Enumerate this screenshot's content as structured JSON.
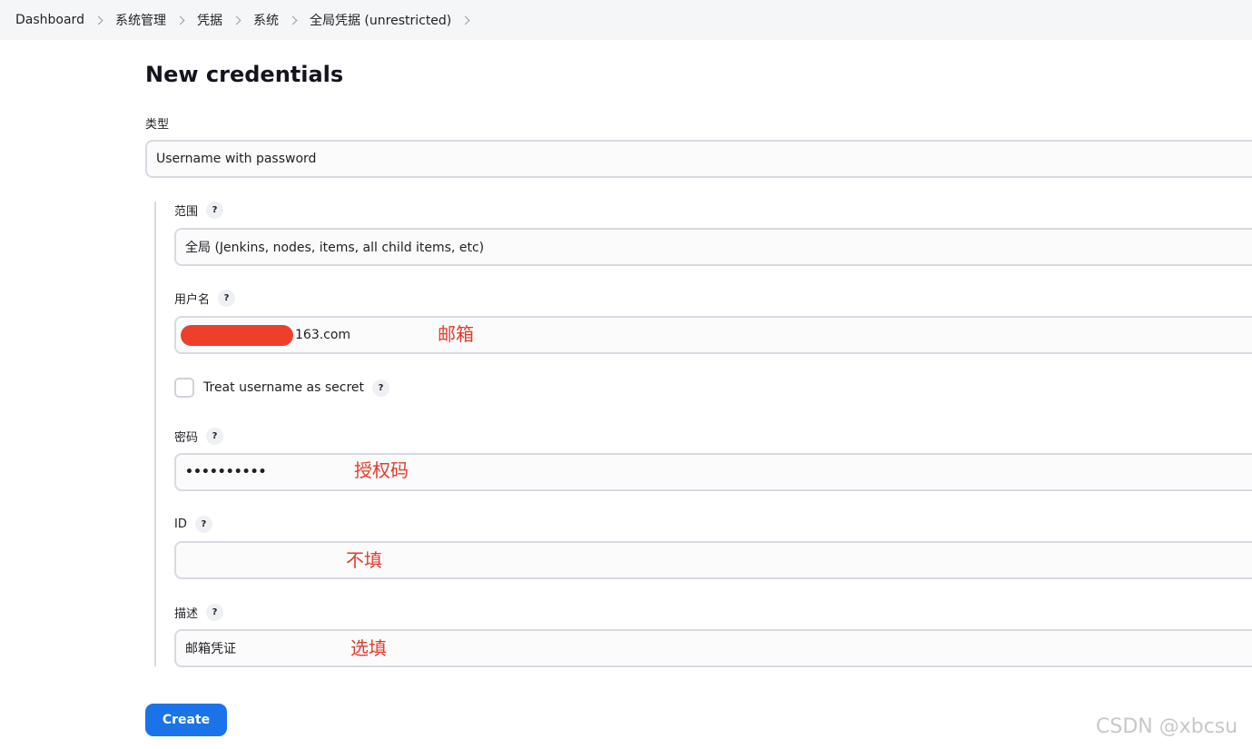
{
  "breadcrumb": {
    "items": [
      "Dashboard",
      "系统管理",
      "凭据",
      "系统",
      "全局凭据 (unrestricted)"
    ]
  },
  "page": {
    "title": "New credentials"
  },
  "form": {
    "kind_label": "类型",
    "kind_value": "Username with password",
    "scope_label": "范围",
    "scope_value": "全局 (Jenkins, nodes, items, all child items, etc)",
    "username_label": "用户名",
    "username_value": "163.com",
    "treat_secret_label": "Treat username as secret",
    "treat_secret_checked": false,
    "password_label": "密码",
    "password_value": "••••••••••",
    "id_label": "ID",
    "id_value": "",
    "description_label": "描述",
    "description_value": "邮箱凭证",
    "help_glyph": "?",
    "create_label": "Create"
  },
  "annotations": {
    "username_note": "邮箱",
    "password_note": "授权码",
    "id_note": "不填",
    "description_note": "选填"
  },
  "watermark": "CSDN @xbcsu",
  "colors": {
    "accent": "#1a73e8",
    "annotation": "#e03c2b",
    "redaction": "#ee3f2a",
    "breadcrumb_bg": "#f5f6f8"
  }
}
